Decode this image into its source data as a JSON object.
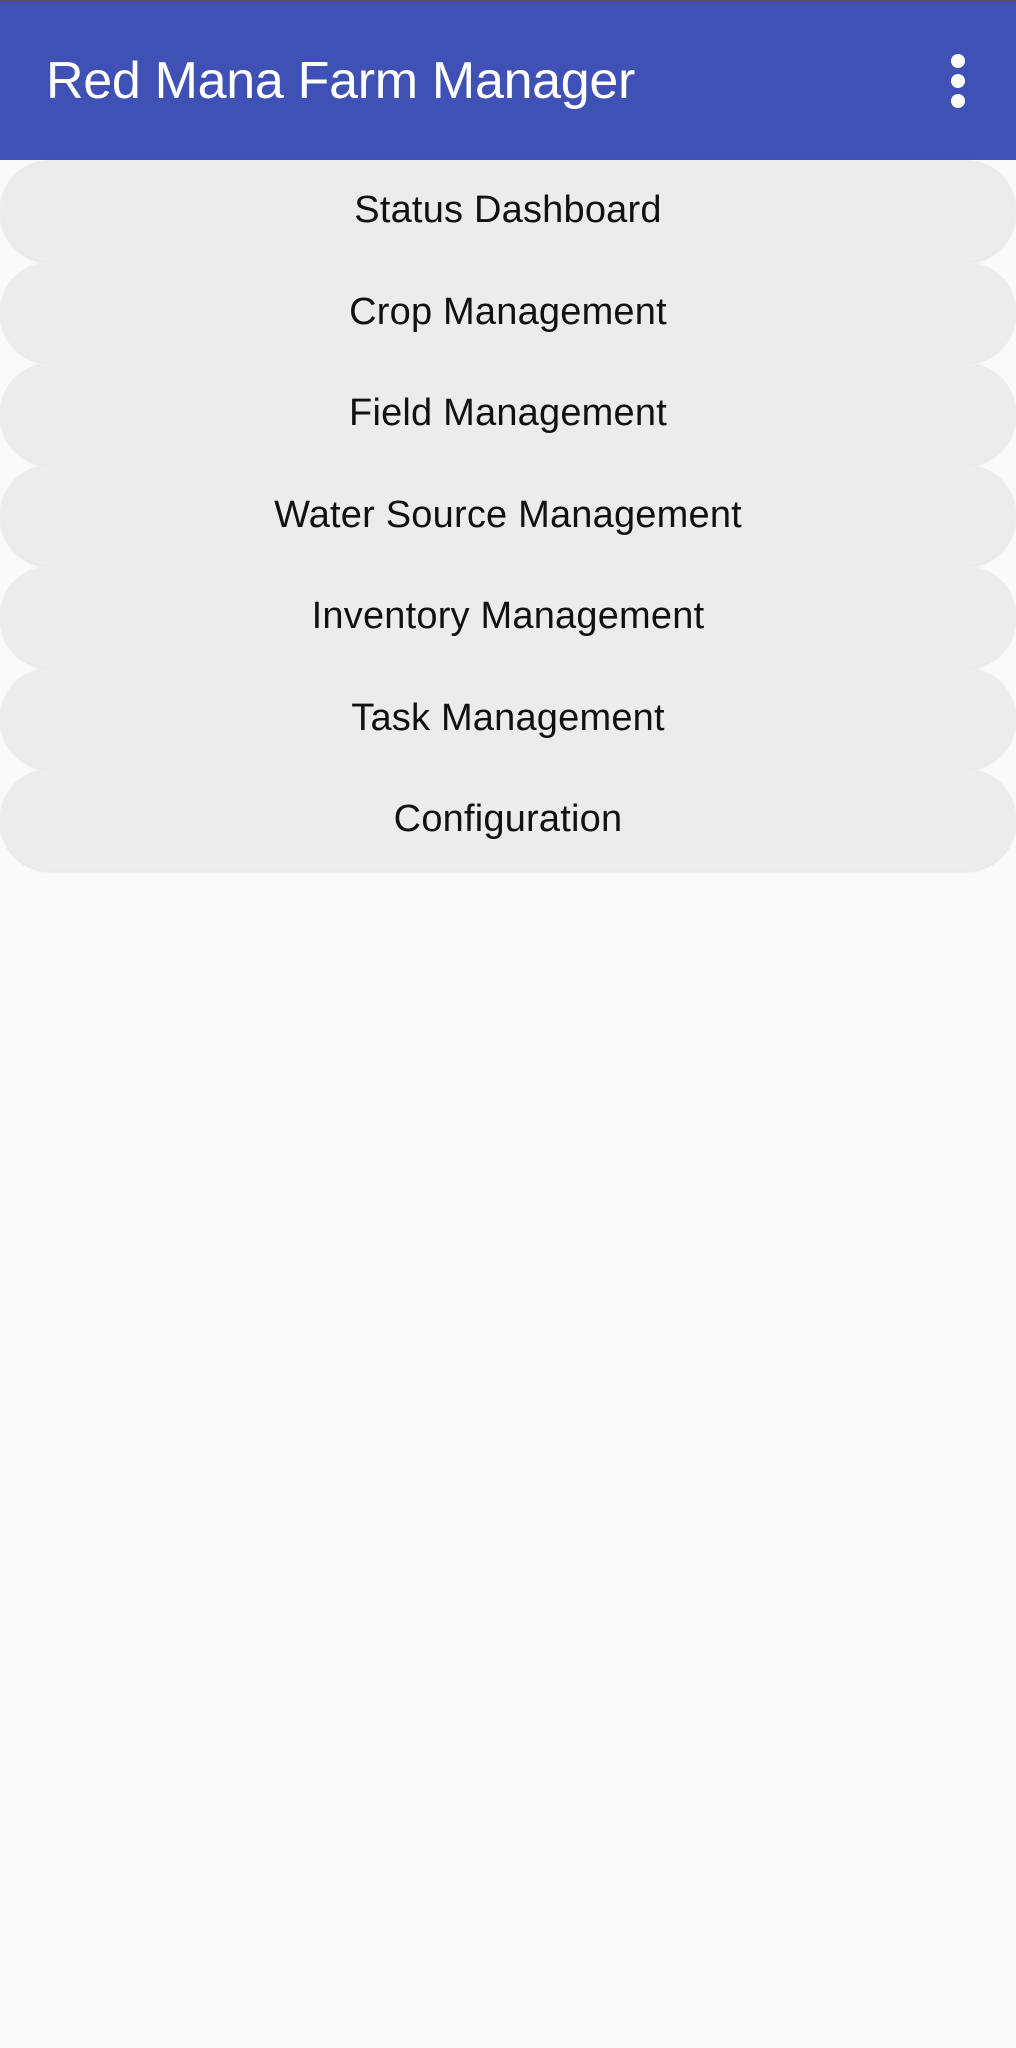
{
  "app": {
    "title": "Red Mana Farm Manager",
    "overflow_icon": "more-vert-icon",
    "colors": {
      "app_bar": "#3f51b5",
      "button_bg": "#ececec",
      "background": "#fafafa"
    }
  },
  "menu": {
    "items": [
      {
        "label": "Status Dashboard"
      },
      {
        "label": "Crop Management"
      },
      {
        "label": "Field Management"
      },
      {
        "label": "Water Source Management"
      },
      {
        "label": "Inventory Management"
      },
      {
        "label": "Task Management"
      },
      {
        "label": "Configuration"
      }
    ]
  }
}
